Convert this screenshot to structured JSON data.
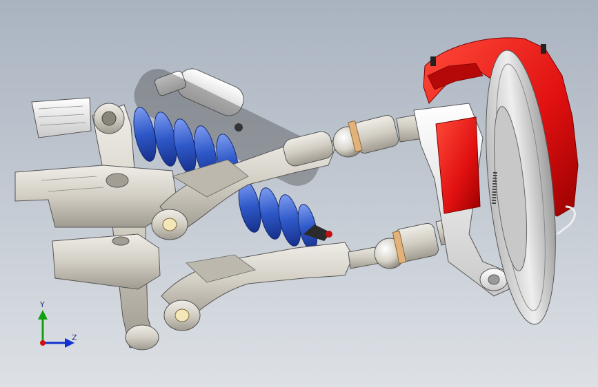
{
  "viewport": {
    "colors": {
      "caliper": "#e01010",
      "caliper_dark": "#8a0000",
      "spring": "#2e58c8",
      "spring_dark": "#17308a",
      "metal": "#d7d3c9",
      "metal_dark": "#6a665f",
      "rotor": "#cfcfcf",
      "reservoir": "#f2f2f2",
      "axis_x": "#d01010",
      "axis_y": "#10a010",
      "axis_z": "#1030d0"
    }
  },
  "triad": {
    "y_label": "Y",
    "z_label": "Z"
  }
}
